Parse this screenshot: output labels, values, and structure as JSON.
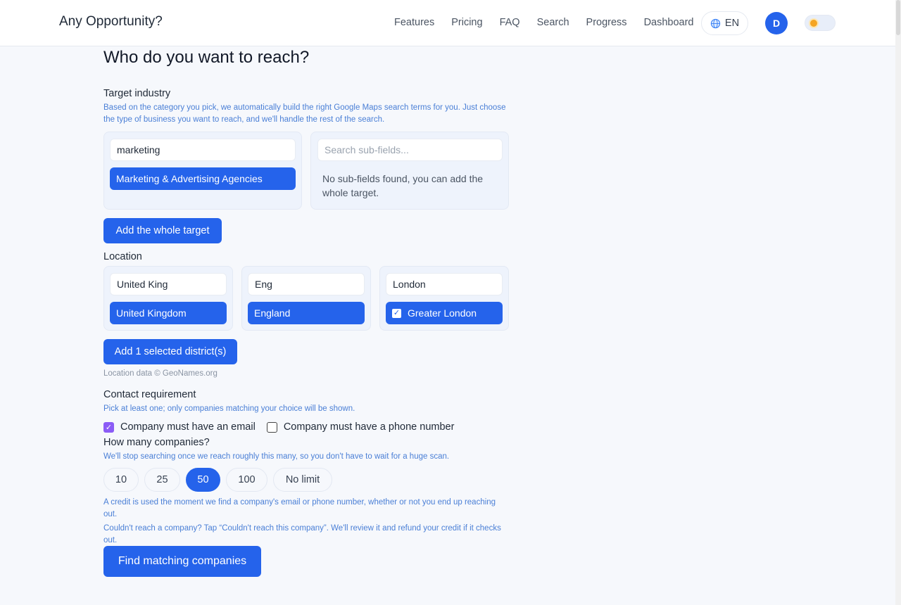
{
  "header": {
    "brand": "Any Opportunity?",
    "nav": [
      "Features",
      "Pricing",
      "FAQ",
      "Search",
      "Progress",
      "Dashboard"
    ],
    "language": "EN",
    "avatar_initial": "D"
  },
  "page": {
    "title": "Who do you want to reach?"
  },
  "industry": {
    "label": "Target industry",
    "hint": "Based on the category you pick, we automatically build the right Google Maps search terms for you. Just choose the type of business you want to reach, and we'll handle the rest of the search.",
    "search_value": "marketing",
    "selected_option": "Marketing & Advertising Agencies",
    "subfield_placeholder": "Search sub-fields...",
    "subfield_empty": "No sub-fields found, you can add the whole target.",
    "add_button": "Add the whole target"
  },
  "location": {
    "label": "Location",
    "country_value": "United King",
    "country_option": "United Kingdom",
    "region_value": "Eng",
    "region_option": "England",
    "district_value": "London",
    "district_option": "Greater London",
    "add_button": "Add 1 selected district(s)",
    "credit": "Location data © GeoNames.org"
  },
  "contact": {
    "label": "Contact requirement",
    "hint": "Pick at least one; only companies matching your choice will be shown.",
    "email_label": "Company must have an email",
    "email_checked": true,
    "phone_label": "Company must have a phone number",
    "phone_checked": false
  },
  "count": {
    "label": "How many companies?",
    "hint": "We'll stop searching once we reach roughly this many, so you don't have to wait for a huge scan.",
    "options": [
      "10",
      "25",
      "50",
      "100",
      "No limit"
    ],
    "selected": "50",
    "credit_note": "A credit is used the moment we find a company's email or phone number, whether or not you end up reaching out.",
    "refund_note": "Couldn't reach a company? Tap “Couldn't reach this company”. We'll review it and refund your credit if it checks out."
  },
  "submit": {
    "label": "Find matching companies"
  },
  "colors": {
    "accent": "#2563eb",
    "checkbox": "#8b5cf6",
    "hint": "#4a7fd6"
  }
}
